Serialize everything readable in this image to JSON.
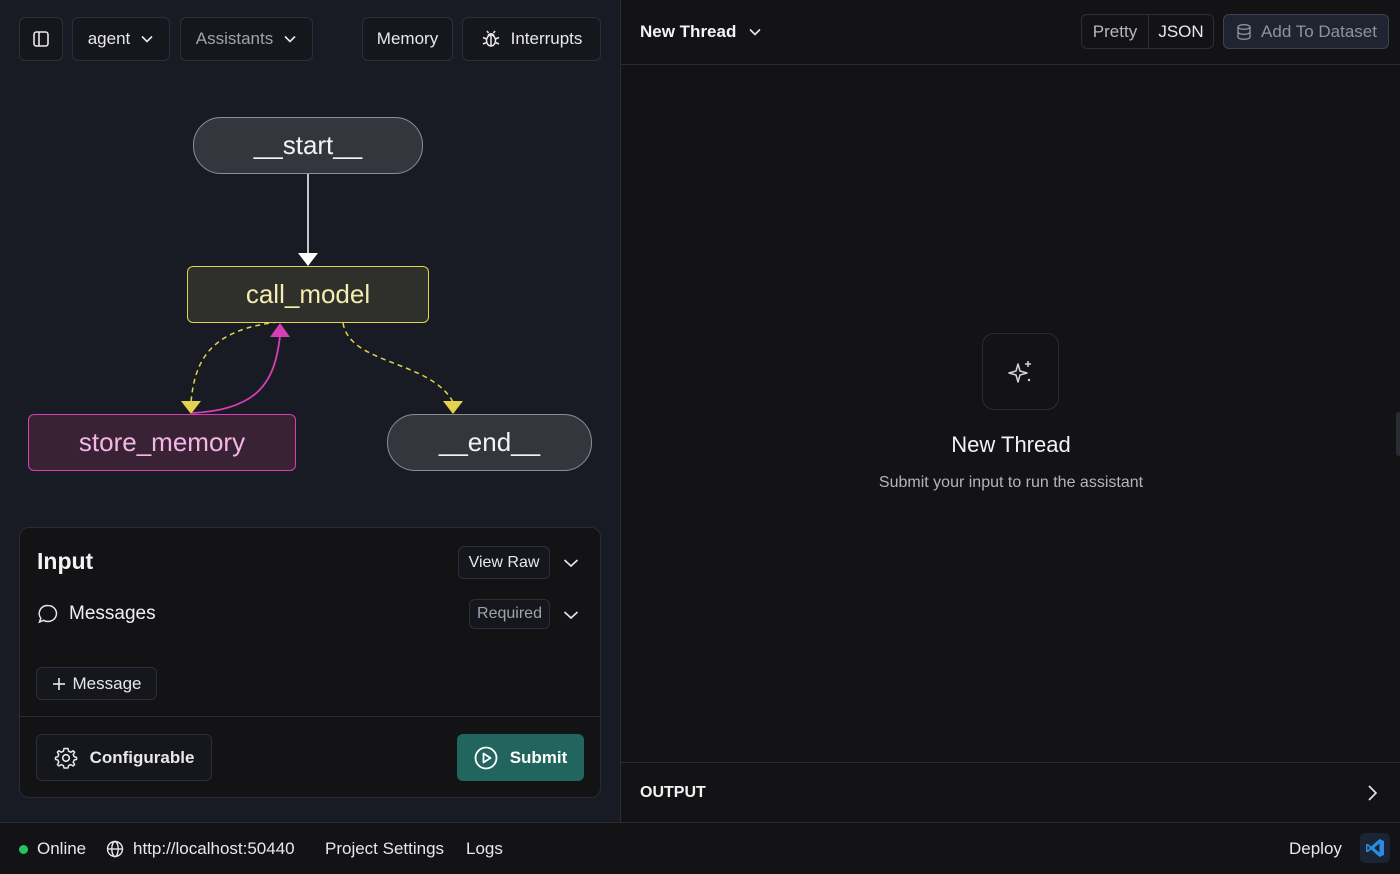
{
  "toolbar": {
    "agent_label": "agent",
    "assistants_label": "Assistants",
    "memory_label": "Memory",
    "interrupts_label": "Interrupts"
  },
  "graph": {
    "nodes": {
      "start": "__start__",
      "call_model": "call_model",
      "store_memory": "store_memory",
      "end": "__end__"
    },
    "colors": {
      "call_model": "#e3d24e",
      "store_memory": "#d63fb4",
      "edge": "#ffffff"
    }
  },
  "input_panel": {
    "title": "Input",
    "view_raw_label": "View Raw",
    "messages_label": "Messages",
    "required_label": "Required",
    "add_message_label": "Message",
    "configurable_label": "Configurable",
    "submit_label": "Submit"
  },
  "thread": {
    "selector_label": "New Thread",
    "pretty_label": "Pretty",
    "json_label": "JSON",
    "add_to_dataset_label": "Add To Dataset",
    "empty_title": "New Thread",
    "empty_subtitle": "Submit your input to run the assistant",
    "output_label": "OUTPUT"
  },
  "statusbar": {
    "status": "Online",
    "status_color": "#22c55e",
    "url": "http://localhost:50440",
    "project_settings": "Project Settings",
    "logs": "Logs",
    "deploy": "Deploy"
  }
}
